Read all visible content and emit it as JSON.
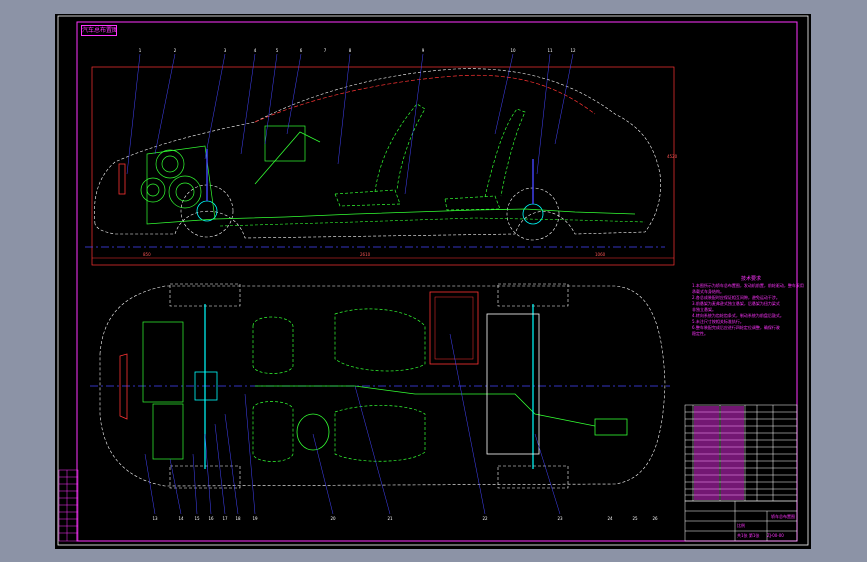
{
  "sheet_label": "汽车总布置图",
  "notes": {
    "title": "技术要求",
    "lines": [
      "1.本图所示为轿车总布置图，发动机前置，前轮驱动，整车采用",
      "  承载式车身结构。",
      "2.各总成装配时应保证相互间隙，避免运动干涉。",
      "3.前悬架为麦弗逊式独立悬架，后悬架为扭力梁式",
      "  非独立悬架。",
      "4.转向系统为齿轮齿条式，制动系统为前盘后鼓式。",
      "5.未注尺寸按相关标准执行。",
      "6.整车装配完成后应进行四轮定位调整，确保行驶",
      "  稳定性。"
    ]
  },
  "dimensions": {
    "overall": "4520",
    "front_overhang": "850",
    "wheelbase": "2610",
    "rear_overhang": "1060"
  },
  "title_block": {
    "drawing_title": "轿车总布置图",
    "drawing_no": "ZJ-00-00",
    "scale_label": "比例",
    "sheet_label": "共1张 第1张"
  },
  "colors": {
    "frame": "#ff33ff",
    "body_outline": "#ff3333",
    "chassis": "#33ff33",
    "centerline": "#4444ff",
    "hidden": "#ffffff",
    "parts": "#00ffff"
  },
  "balloons": {
    "side_view": [
      "1",
      "2",
      "3",
      "4",
      "5",
      "6",
      "7",
      "8",
      "9",
      "10",
      "11",
      "12"
    ],
    "top_view": [
      "13",
      "14",
      "15",
      "16",
      "17",
      "18",
      "19",
      "20",
      "21",
      "22",
      "23",
      "24",
      "25",
      "26"
    ]
  }
}
